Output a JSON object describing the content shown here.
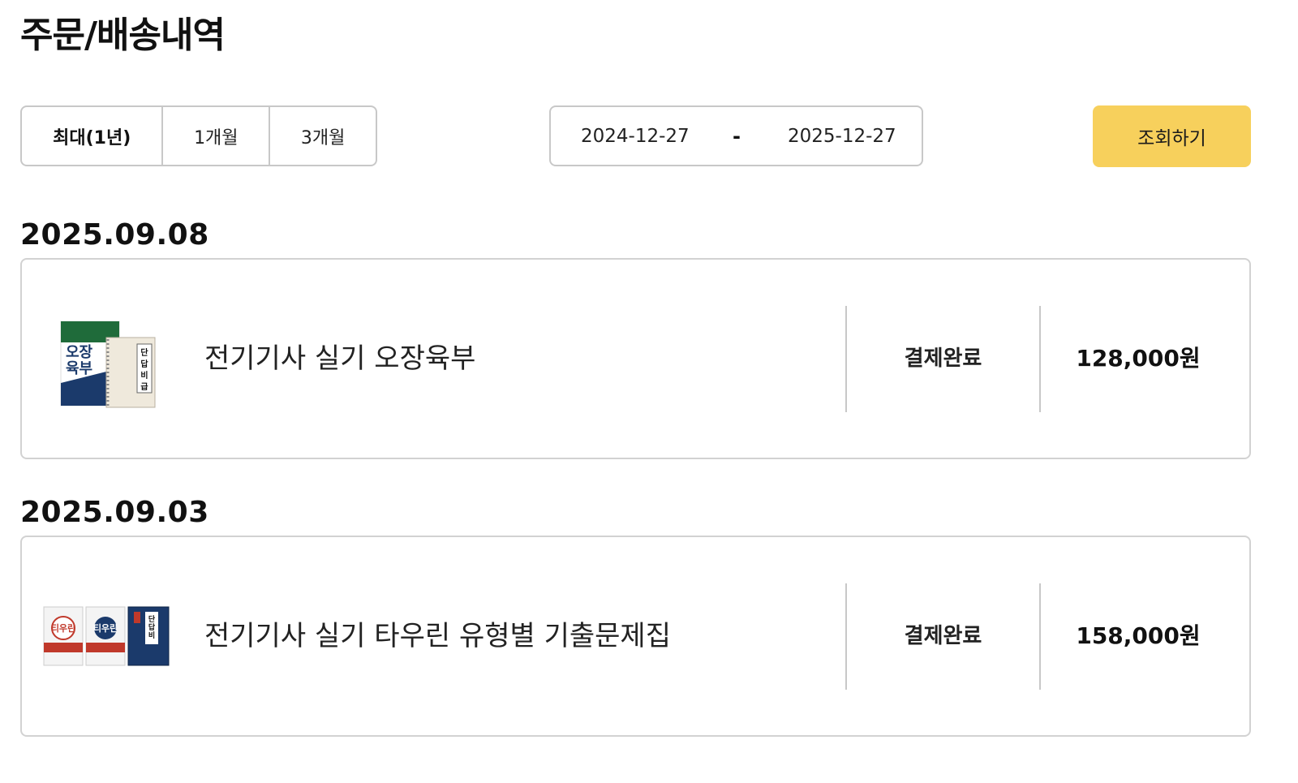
{
  "page": {
    "title": "주문/배송내역"
  },
  "filters": {
    "periods": [
      {
        "label": "최대(1년)",
        "selected": true
      },
      {
        "label": "1개월",
        "selected": false
      },
      {
        "label": "3개월",
        "selected": false
      }
    ],
    "date_start": "2024-12-27",
    "date_separator": "-",
    "date_end": "2025-12-27",
    "search_label": "조회하기"
  },
  "colors": {
    "accent": "#f7d05c",
    "border": "#c8c8c8",
    "book_green": "#1f6b3a",
    "book_navy": "#1b3a6b",
    "book_red": "#c0392b"
  },
  "orders": [
    {
      "date": "2025.09.08",
      "thumbnail_icon": "book-bundle-thumbnail",
      "thumbnail_text": [
        "오장",
        "육부",
        "단 답 비 급"
      ],
      "product": "전기기사 실기 오장육부",
      "status": "결제완료",
      "price": "128,000원"
    },
    {
      "date": "2025.09.03",
      "thumbnail_icon": "book-bundle-thumbnail",
      "thumbnail_text": [
        "티우린",
        "티우린",
        "단 답 비 급"
      ],
      "product": "전기기사 실기 타우린 유형별 기출문제집",
      "status": "결제완료",
      "price": "158,000원"
    }
  ]
}
